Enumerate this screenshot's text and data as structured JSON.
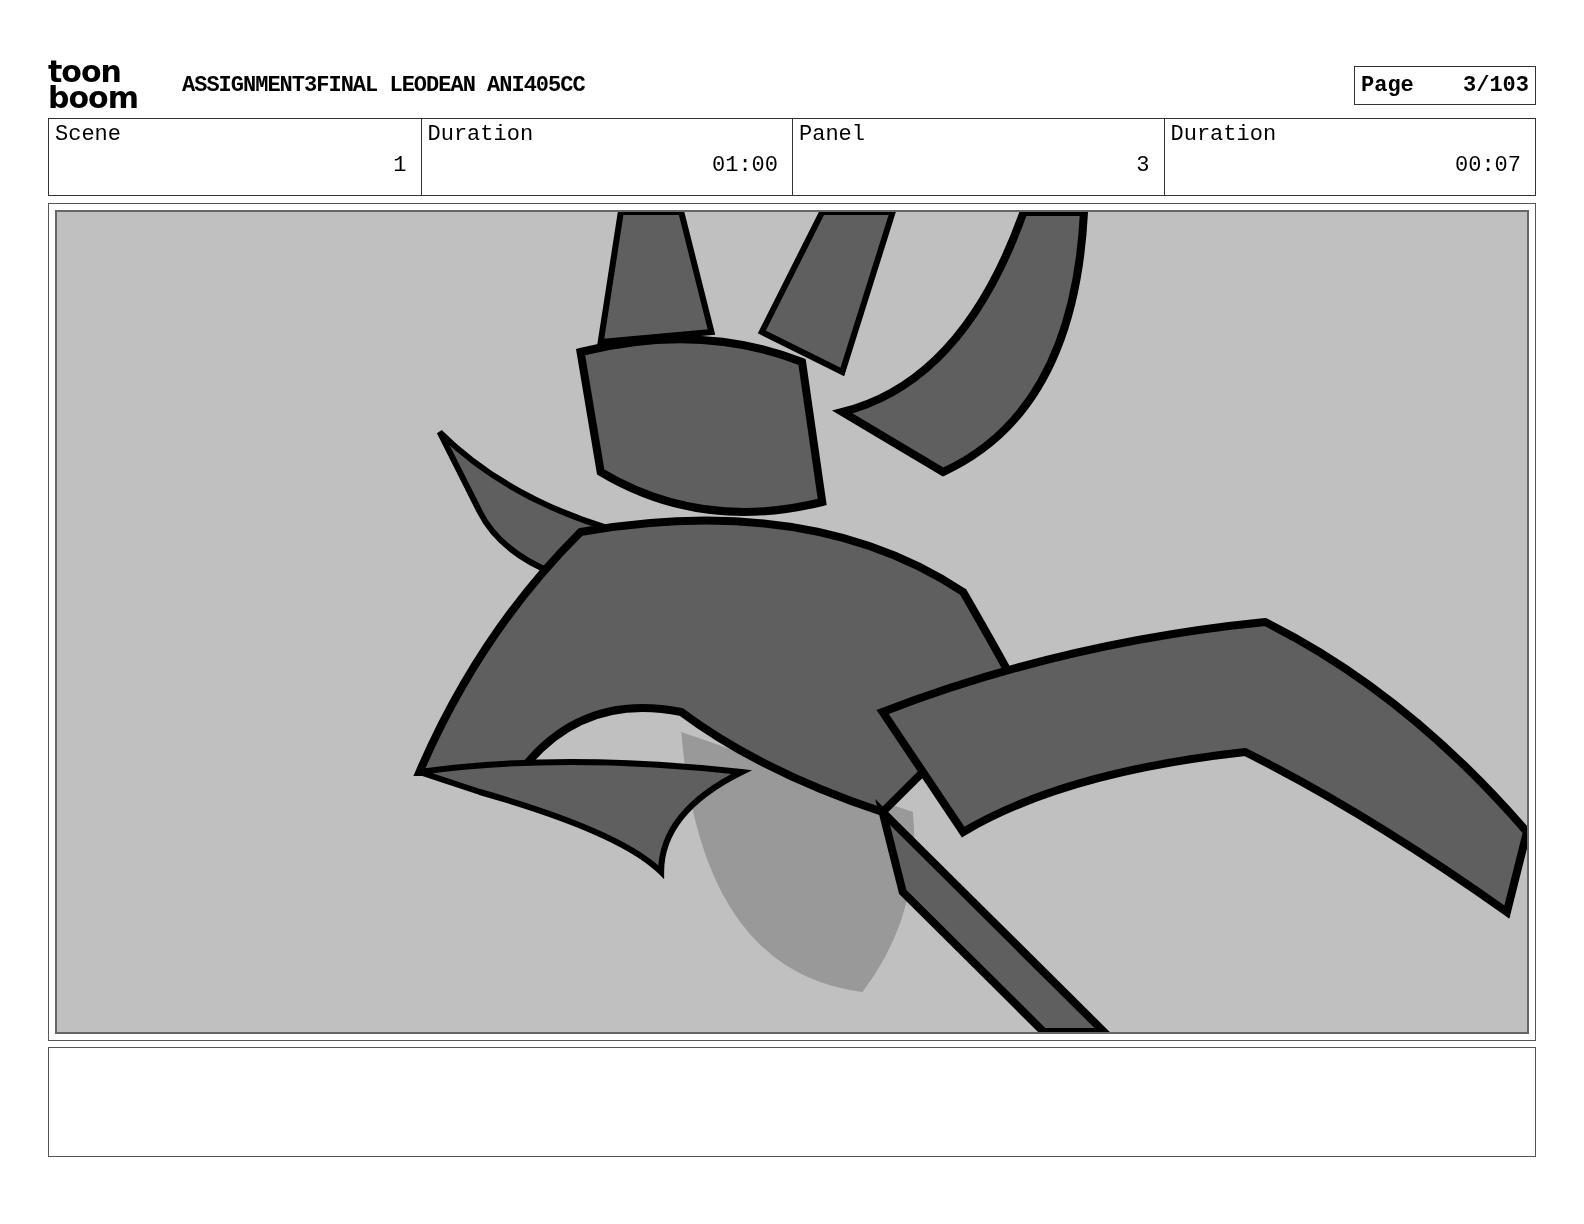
{
  "logo": {
    "lines": [
      "toon",
      "boom"
    ]
  },
  "title": "ASSIGNMENT3FINAL LEODEAN ANI405CC",
  "page": {
    "label": "Page",
    "value": "3/103"
  },
  "fields": [
    {
      "label": "Scene",
      "value": "1"
    },
    {
      "label": "Duration",
      "value": "01:00"
    },
    {
      "label": "Panel",
      "value": "3"
    },
    {
      "label": "Duration",
      "value": "00:07"
    }
  ]
}
